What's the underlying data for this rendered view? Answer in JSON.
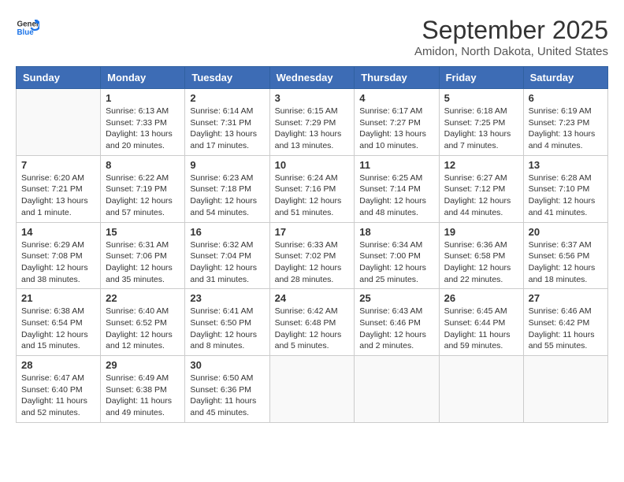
{
  "header": {
    "logo_general": "General",
    "logo_blue": "Blue",
    "month": "September 2025",
    "location": "Amidon, North Dakota, United States"
  },
  "weekdays": [
    "Sunday",
    "Monday",
    "Tuesday",
    "Wednesday",
    "Thursday",
    "Friday",
    "Saturday"
  ],
  "weeks": [
    [
      {
        "day": "",
        "info": ""
      },
      {
        "day": "1",
        "info": "Sunrise: 6:13 AM\nSunset: 7:33 PM\nDaylight: 13 hours\nand 20 minutes."
      },
      {
        "day": "2",
        "info": "Sunrise: 6:14 AM\nSunset: 7:31 PM\nDaylight: 13 hours\nand 17 minutes."
      },
      {
        "day": "3",
        "info": "Sunrise: 6:15 AM\nSunset: 7:29 PM\nDaylight: 13 hours\nand 13 minutes."
      },
      {
        "day": "4",
        "info": "Sunrise: 6:17 AM\nSunset: 7:27 PM\nDaylight: 13 hours\nand 10 minutes."
      },
      {
        "day": "5",
        "info": "Sunrise: 6:18 AM\nSunset: 7:25 PM\nDaylight: 13 hours\nand 7 minutes."
      },
      {
        "day": "6",
        "info": "Sunrise: 6:19 AM\nSunset: 7:23 PM\nDaylight: 13 hours\nand 4 minutes."
      }
    ],
    [
      {
        "day": "7",
        "info": "Sunrise: 6:20 AM\nSunset: 7:21 PM\nDaylight: 13 hours\nand 1 minute."
      },
      {
        "day": "8",
        "info": "Sunrise: 6:22 AM\nSunset: 7:19 PM\nDaylight: 12 hours\nand 57 minutes."
      },
      {
        "day": "9",
        "info": "Sunrise: 6:23 AM\nSunset: 7:18 PM\nDaylight: 12 hours\nand 54 minutes."
      },
      {
        "day": "10",
        "info": "Sunrise: 6:24 AM\nSunset: 7:16 PM\nDaylight: 12 hours\nand 51 minutes."
      },
      {
        "day": "11",
        "info": "Sunrise: 6:25 AM\nSunset: 7:14 PM\nDaylight: 12 hours\nand 48 minutes."
      },
      {
        "day": "12",
        "info": "Sunrise: 6:27 AM\nSunset: 7:12 PM\nDaylight: 12 hours\nand 44 minutes."
      },
      {
        "day": "13",
        "info": "Sunrise: 6:28 AM\nSunset: 7:10 PM\nDaylight: 12 hours\nand 41 minutes."
      }
    ],
    [
      {
        "day": "14",
        "info": "Sunrise: 6:29 AM\nSunset: 7:08 PM\nDaylight: 12 hours\nand 38 minutes."
      },
      {
        "day": "15",
        "info": "Sunrise: 6:31 AM\nSunset: 7:06 PM\nDaylight: 12 hours\nand 35 minutes."
      },
      {
        "day": "16",
        "info": "Sunrise: 6:32 AM\nSunset: 7:04 PM\nDaylight: 12 hours\nand 31 minutes."
      },
      {
        "day": "17",
        "info": "Sunrise: 6:33 AM\nSunset: 7:02 PM\nDaylight: 12 hours\nand 28 minutes."
      },
      {
        "day": "18",
        "info": "Sunrise: 6:34 AM\nSunset: 7:00 PM\nDaylight: 12 hours\nand 25 minutes."
      },
      {
        "day": "19",
        "info": "Sunrise: 6:36 AM\nSunset: 6:58 PM\nDaylight: 12 hours\nand 22 minutes."
      },
      {
        "day": "20",
        "info": "Sunrise: 6:37 AM\nSunset: 6:56 PM\nDaylight: 12 hours\nand 18 minutes."
      }
    ],
    [
      {
        "day": "21",
        "info": "Sunrise: 6:38 AM\nSunset: 6:54 PM\nDaylight: 12 hours\nand 15 minutes."
      },
      {
        "day": "22",
        "info": "Sunrise: 6:40 AM\nSunset: 6:52 PM\nDaylight: 12 hours\nand 12 minutes."
      },
      {
        "day": "23",
        "info": "Sunrise: 6:41 AM\nSunset: 6:50 PM\nDaylight: 12 hours\nand 8 minutes."
      },
      {
        "day": "24",
        "info": "Sunrise: 6:42 AM\nSunset: 6:48 PM\nDaylight: 12 hours\nand 5 minutes."
      },
      {
        "day": "25",
        "info": "Sunrise: 6:43 AM\nSunset: 6:46 PM\nDaylight: 12 hours\nand 2 minutes."
      },
      {
        "day": "26",
        "info": "Sunrise: 6:45 AM\nSunset: 6:44 PM\nDaylight: 11 hours\nand 59 minutes."
      },
      {
        "day": "27",
        "info": "Sunrise: 6:46 AM\nSunset: 6:42 PM\nDaylight: 11 hours\nand 55 minutes."
      }
    ],
    [
      {
        "day": "28",
        "info": "Sunrise: 6:47 AM\nSunset: 6:40 PM\nDaylight: 11 hours\nand 52 minutes."
      },
      {
        "day": "29",
        "info": "Sunrise: 6:49 AM\nSunset: 6:38 PM\nDaylight: 11 hours\nand 49 minutes."
      },
      {
        "day": "30",
        "info": "Sunrise: 6:50 AM\nSunset: 6:36 PM\nDaylight: 11 hours\nand 45 minutes."
      },
      {
        "day": "",
        "info": ""
      },
      {
        "day": "",
        "info": ""
      },
      {
        "day": "",
        "info": ""
      },
      {
        "day": "",
        "info": ""
      }
    ]
  ]
}
